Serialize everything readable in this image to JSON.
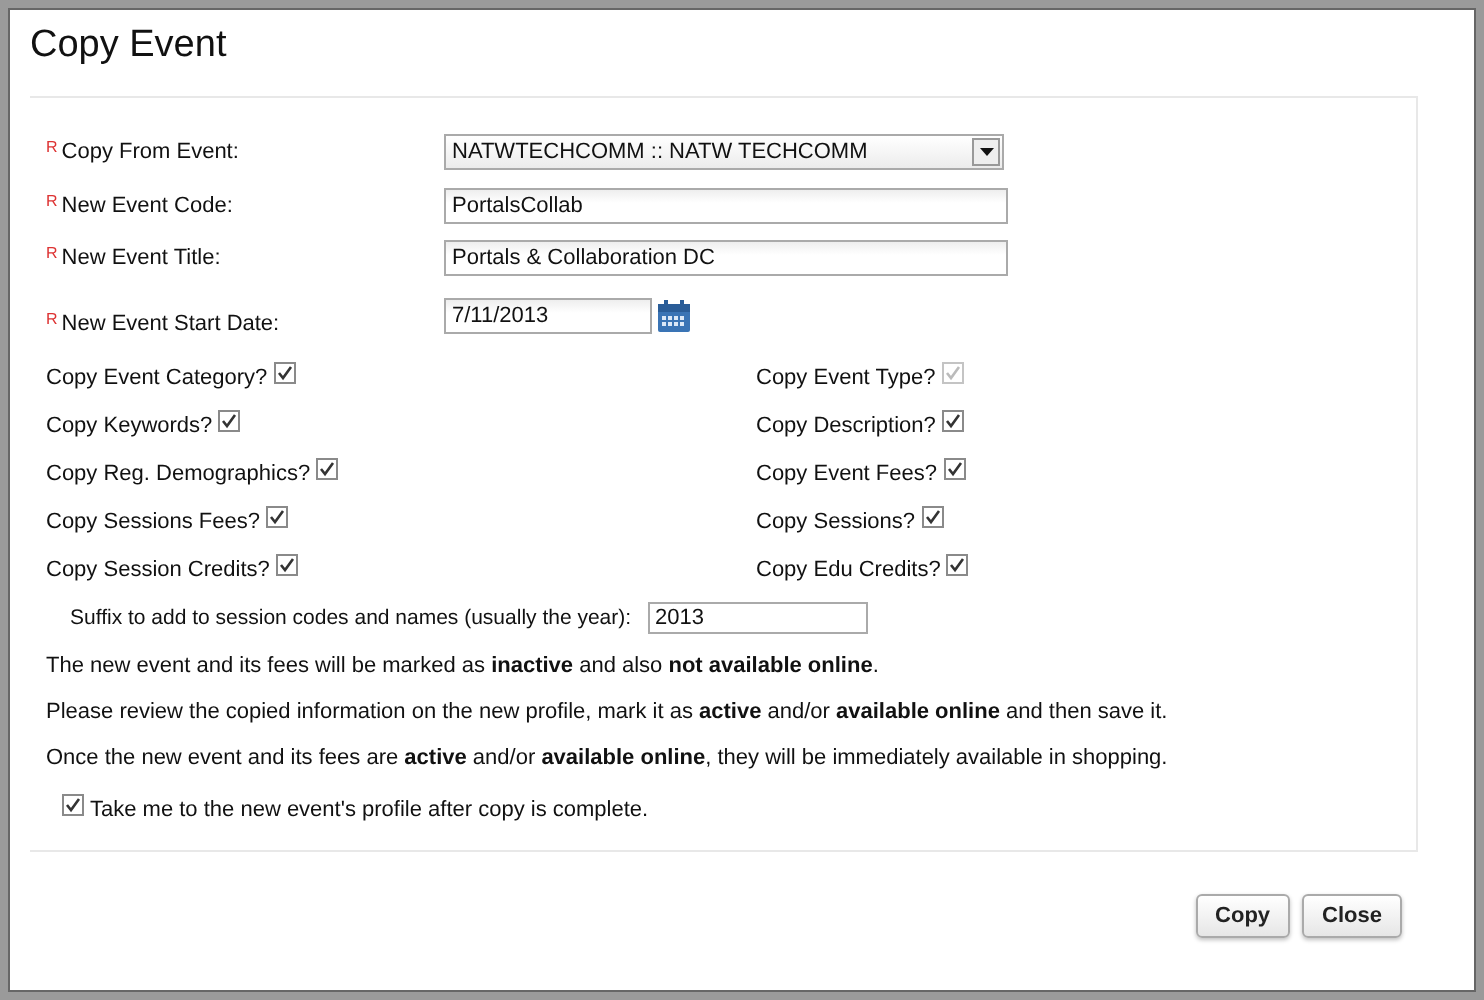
{
  "window": {
    "title": "Copy Event"
  },
  "fields": [
    {
      "kind": "select",
      "required_mark": "R",
      "label": "Copy From Event:",
      "value": "NATWTECHCOMM :: NATW TECHCOMM"
    },
    {
      "kind": "text",
      "required_mark": "R",
      "label": "New Event Code:",
      "value": "PortalsCollab"
    },
    {
      "kind": "text",
      "required_mark": "R",
      "label": "New Event Title:",
      "value": "Portals & Collaboration DC"
    },
    {
      "kind": "date",
      "required_mark": "R",
      "label": "New Event Start Date:",
      "value": "7/11/2013"
    }
  ],
  "options_left": [
    {
      "label": "Copy Event Category?",
      "checked": true,
      "disabled": false
    },
    {
      "label": "Copy Keywords?",
      "checked": true,
      "disabled": false
    },
    {
      "label": "Copy Reg. Demographics?",
      "checked": true,
      "disabled": false
    },
    {
      "label": "Copy Sessions Fees?",
      "checked": true,
      "disabled": false
    },
    {
      "label": "Copy Session Credits?",
      "checked": true,
      "disabled": false
    }
  ],
  "options_right": [
    {
      "label": "Copy Event Type?",
      "checked": true,
      "disabled": true
    },
    {
      "label": "Copy Description?",
      "checked": true,
      "disabled": false
    },
    {
      "label": "Copy Event Fees?",
      "checked": true,
      "disabled": false
    },
    {
      "label": "Copy Sessions?",
      "checked": true,
      "disabled": false
    },
    {
      "label": "Copy Edu Credits?",
      "checked": true,
      "disabled": false
    }
  ],
  "suffix": {
    "label": "Suffix to add to session codes and names (usually the year):",
    "value": "2013"
  },
  "notes": [
    "The new event and its fees will be marked as **inactive** and also **not available online**.",
    "Please review the copied information on the new profile, mark it as **active** and/or **available online** and then save it.",
    "Once the new event and its fees are **active** and/or **available online**, they will be immediately available in shopping."
  ],
  "redirect": {
    "label": "Take me to the new event's profile after copy is complete.",
    "checked": true
  },
  "buttons": [
    "Copy",
    "Close"
  ]
}
